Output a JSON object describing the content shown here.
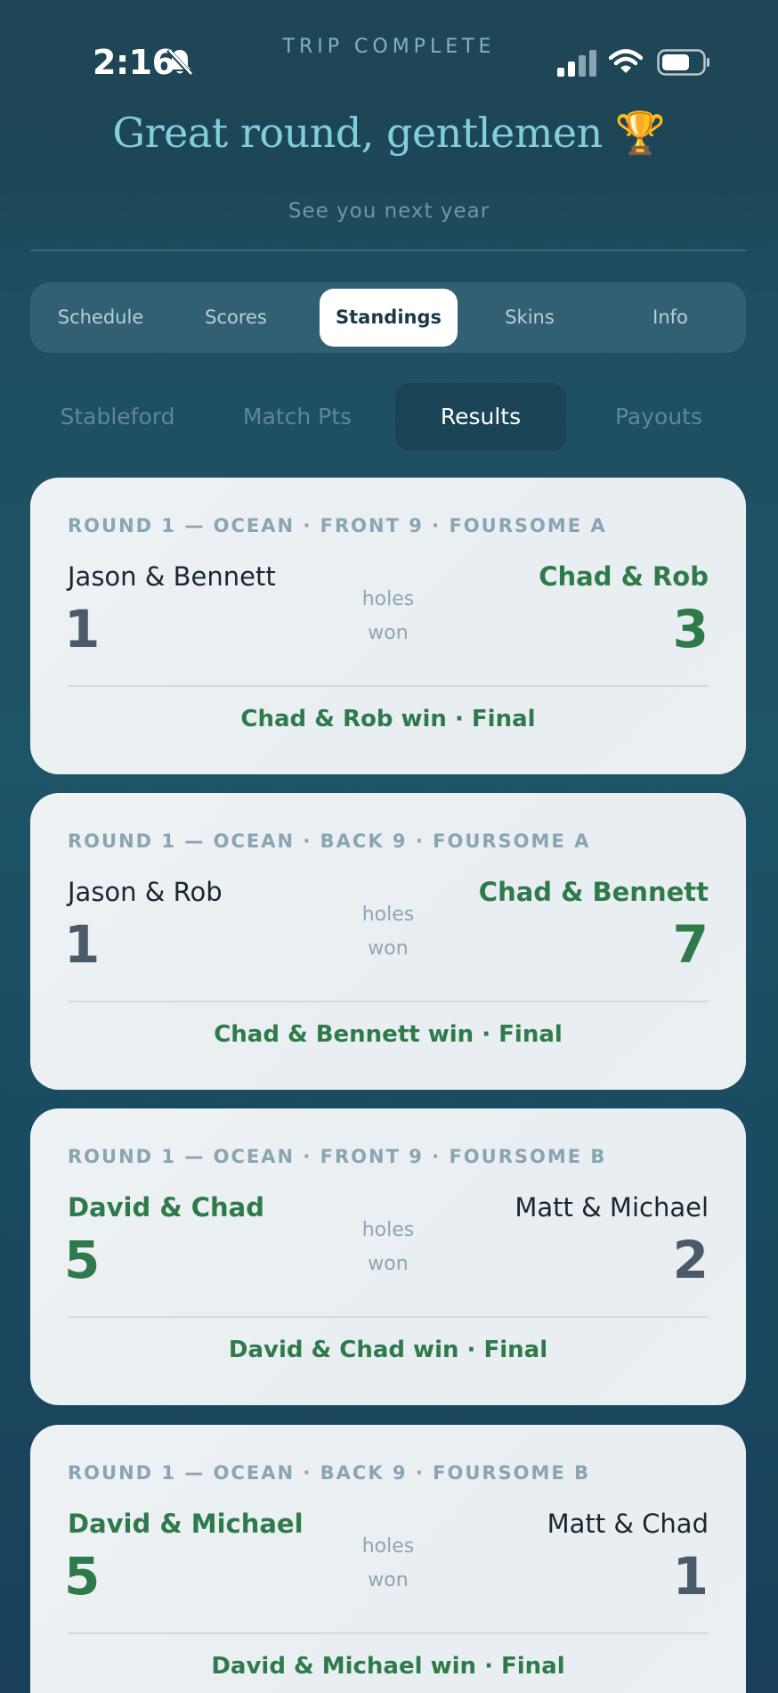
{
  "status_bar": {
    "time": "2:16",
    "center_label": "TRIP COMPLETE",
    "icons": [
      "bell-off-icon",
      "signal-icon",
      "wifi-icon",
      "battery-icon"
    ]
  },
  "header": {
    "headline": "Great round, gentlemen 🏆",
    "subline": "See you next year"
  },
  "main_tabs": [
    {
      "label": "Schedule",
      "active": false
    },
    {
      "label": "Scores",
      "active": false
    },
    {
      "label": "Standings",
      "active": true
    },
    {
      "label": "Skins",
      "active": false
    },
    {
      "label": "Info",
      "active": false
    }
  ],
  "sub_tabs": [
    {
      "label": "Stableford",
      "active": false
    },
    {
      "label": "Match Pts",
      "active": false
    },
    {
      "label": "Results",
      "active": true
    },
    {
      "label": "Payouts",
      "active": false
    }
  ],
  "colors": {
    "winner_green": "#2f7a4a",
    "loser_slate": "#4a5a68",
    "accent_teal": "#82cfdc"
  },
  "matches": [
    {
      "title": "ROUND 1 — OCEAN · FRONT 9 · FOURSOME A",
      "left_team": "Jason & Bennett",
      "left_score": "1",
      "right_team": "Chad & Rob",
      "right_score": "3",
      "winner": "right",
      "middle_top": "holes",
      "middle_bottom": "won",
      "result": "Chad & Rob win · Final"
    },
    {
      "title": "ROUND 1 — OCEAN · BACK 9 · FOURSOME A",
      "left_team": "Jason & Rob",
      "left_score": "1",
      "right_team": "Chad & Bennett",
      "right_score": "7",
      "winner": "right",
      "middle_top": "holes",
      "middle_bottom": "won",
      "result": "Chad & Bennett win · Final"
    },
    {
      "title": "ROUND 1 — OCEAN · FRONT 9 · FOURSOME B",
      "left_team": "David & Chad",
      "left_score": "5",
      "right_team": "Matt & Michael",
      "right_score": "2",
      "winner": "left",
      "middle_top": "holes",
      "middle_bottom": "won",
      "result": "David & Chad win · Final"
    },
    {
      "title": "ROUND 1 — OCEAN · BACK 9 · FOURSOME B",
      "left_team": "David & Michael",
      "left_score": "5",
      "right_team": "Matt & Chad",
      "right_score": "1",
      "winner": "left",
      "middle_top": "holes",
      "middle_bottom": "won",
      "result": "David & Michael win · Final"
    }
  ]
}
